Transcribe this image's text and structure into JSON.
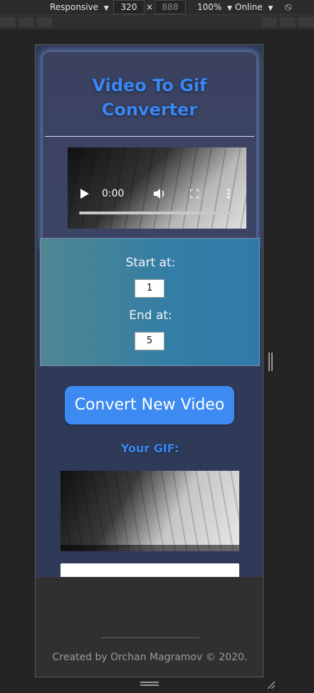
{
  "devtools": {
    "device_mode": "Responsive",
    "width_value": "320",
    "height_value": "888",
    "zoom": "100%",
    "network": "Online",
    "times": "×",
    "dropdown_arrow": "▼",
    "rotate_icon": "⦸"
  },
  "app": {
    "title": "Video To Gif Converter",
    "video": {
      "time": "0:00"
    },
    "start_label": "Start at:",
    "start_value": "1",
    "end_label": "End at:",
    "end_value": "5",
    "convert_button": "Convert New Video",
    "gif_heading": "Your GIF:",
    "footer": "Created by Orchan Magramov © 2020."
  }
}
